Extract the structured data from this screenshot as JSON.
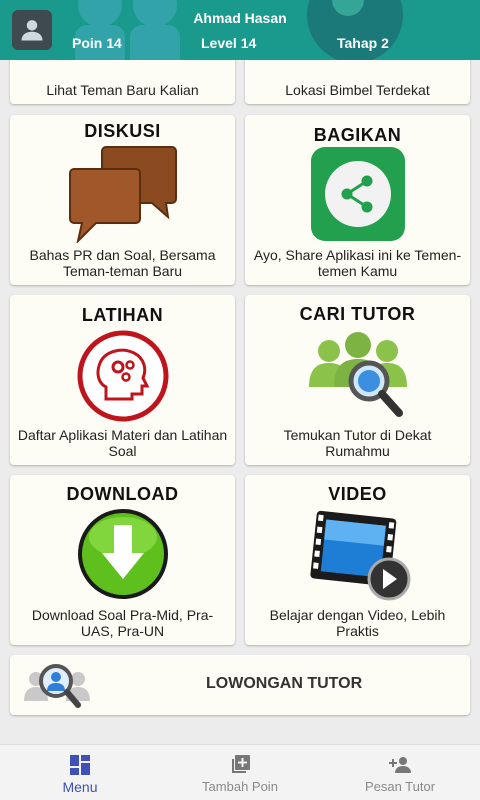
{
  "header": {
    "user_name": "Ahmad Hasan",
    "poin": "Poin 14",
    "level": "Level 14",
    "tahap": "Tahap 2"
  },
  "top_cards": [
    {
      "desc": "Lihat Teman Baru Kalian"
    },
    {
      "desc": "Lokasi Bimbel Terdekat"
    }
  ],
  "cards": [
    {
      "title": "DISKUSI",
      "desc": "Bahas PR dan Soal, Bersama Teman-teman Baru",
      "icon": "chat-bubbles-icon"
    },
    {
      "title": "BAGIKAN",
      "desc": "Ayo, Share Aplikasi ini ke Temen-temen Kamu",
      "icon": "share-icon"
    },
    {
      "title": "LATIHAN",
      "desc": "Daftar Aplikasi Materi dan Latihan Soal",
      "icon": "brain-gears-icon"
    },
    {
      "title": "CARI TUTOR",
      "desc": "Temukan Tutor di Dekat Rumahmu",
      "icon": "people-search-icon"
    },
    {
      "title": "DOWNLOAD",
      "desc": "Download Soal Pra-Mid, Pra-UAS, Pra-UN",
      "icon": "download-arrow-icon"
    },
    {
      "title": "VIDEO",
      "desc": "Belajar dengan Video, Lebih Praktis",
      "icon": "film-play-icon"
    }
  ],
  "lowongan": {
    "label": "LOWONGAN TUTOR",
    "icon": "tutor-search-icon"
  },
  "bottom_nav": [
    {
      "label": "Menu",
      "icon": "grid-menu-icon",
      "active": true
    },
    {
      "label": "Tambah Poin",
      "icon": "add-box-icon",
      "active": false
    },
    {
      "label": "Pesan Tutor",
      "icon": "add-person-icon",
      "active": false
    }
  ],
  "colors": {
    "header_bg": "#1a9a8c",
    "active_nav": "#3f51b5",
    "share_green": "#22a04d",
    "chat_brown": "#8b4a1f",
    "latihan_red": "#c0141c",
    "tutor_green": "#8bc34a"
  }
}
